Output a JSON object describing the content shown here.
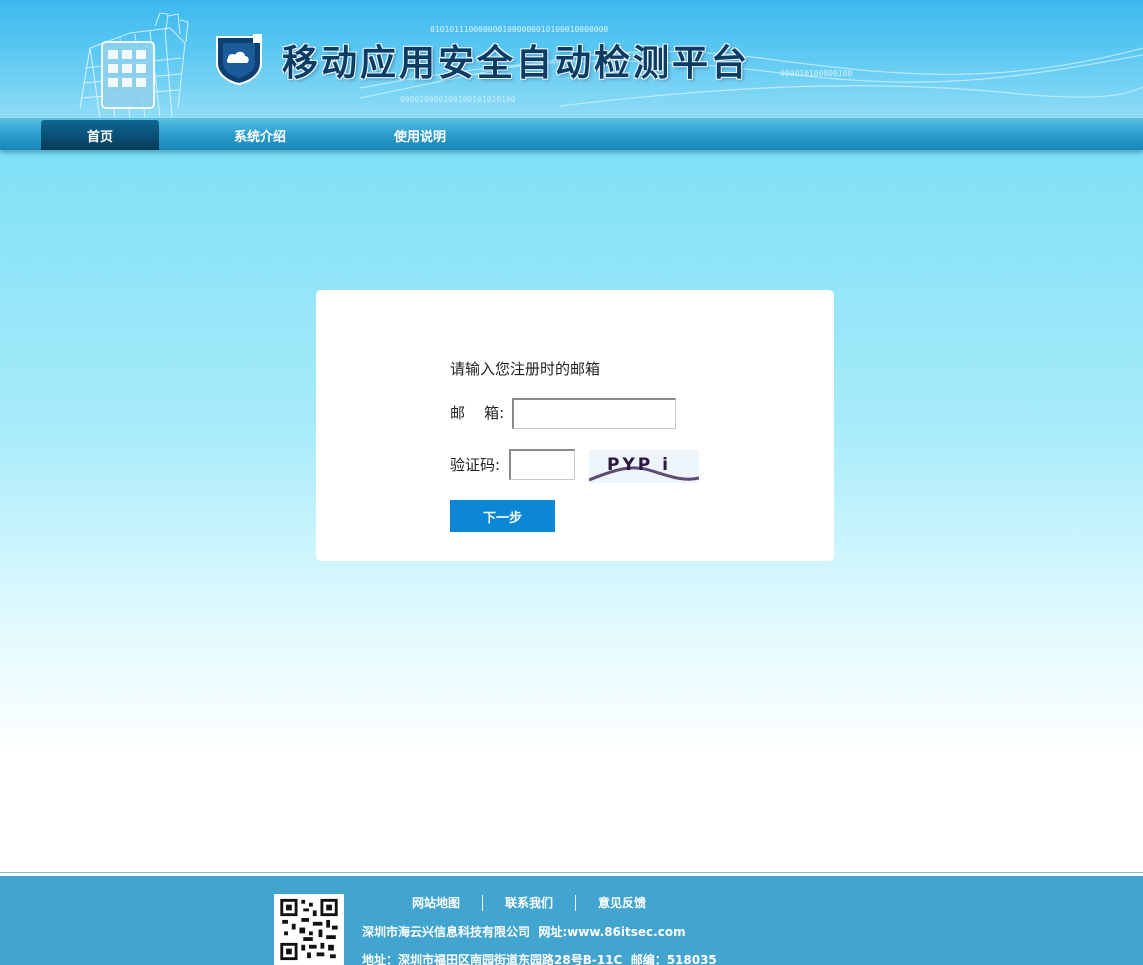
{
  "header": {
    "site_title": "移动应用安全自动检测平台",
    "binary_text": "0101011100000001000000010100010000000",
    "logo": "cloud-shield-logo"
  },
  "nav": {
    "items": [
      {
        "label": "首页",
        "active": true
      },
      {
        "label": "系统介绍",
        "active": false
      },
      {
        "label": "使用说明",
        "active": false
      }
    ]
  },
  "form": {
    "prompt": "请输入您注册时的邮箱",
    "email_label": "邮    箱:",
    "email_value": "",
    "captcha_label": "验证码:",
    "captcha_value": "",
    "captcha_text": "PYP i",
    "submit_label": "下一步"
  },
  "footer": {
    "links": [
      "网站地图",
      "联系我们",
      "意见反馈"
    ],
    "company": "深圳市海云兴信息科技有限公司  网址:www.86itsec.com",
    "address": "地址：深圳市福田区南园街道东园路28号B-11C  邮编：518035",
    "qr_icon": "qr-code"
  },
  "colors": {
    "accent_button": "#0b87d6",
    "nav_active": "#0a4f75",
    "footer_bg": "#41a5cf",
    "title_text": "#0c3b63"
  }
}
